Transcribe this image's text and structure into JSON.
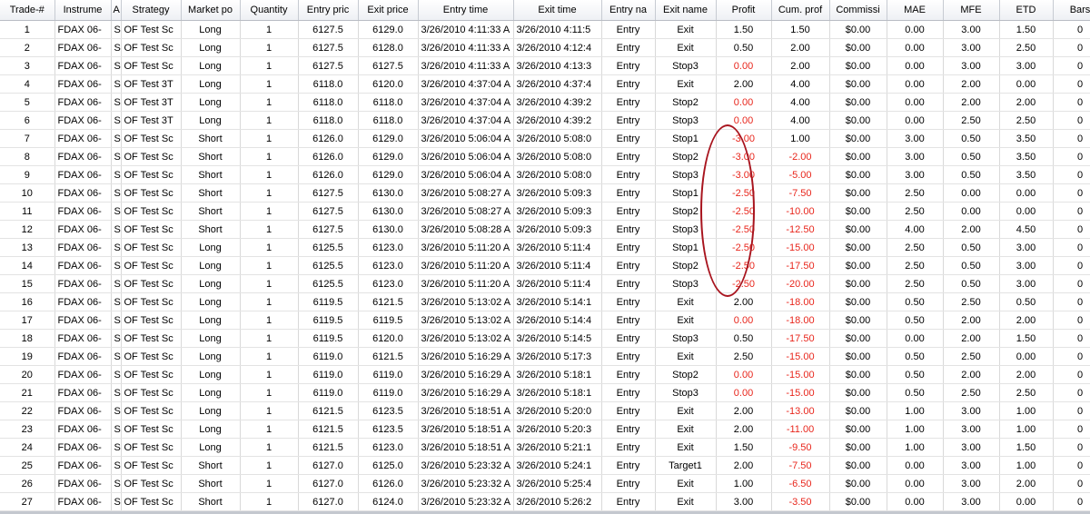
{
  "columns": [
    "Trade-#",
    "Instrume",
    "A",
    "Strategy",
    "Market po",
    "Quantity",
    "Entry pric",
    "Exit price",
    "Entry time",
    "Exit time",
    "Entry na",
    "Exit name",
    "Profit",
    "Cum. prof",
    "Commissi",
    "MAE",
    "MFE",
    "ETD",
    "Bars"
  ],
  "negative_color": "#e8261c",
  "annotation_color": "#a8141e",
  "rows": [
    [
      "1",
      "FDAX 06-",
      "S",
      "OF Test Sc",
      "Long",
      "1",
      "6127.5",
      "6129.0",
      "3/26/2010 4:11:33 A",
      "3/26/2010 4:11:5",
      "Entry",
      "Exit",
      "1.50",
      "1.50",
      "$0.00",
      "0.00",
      "3.00",
      "1.50",
      "0"
    ],
    [
      "2",
      "FDAX 06-",
      "S",
      "OF Test Sc",
      "Long",
      "1",
      "6127.5",
      "6128.0",
      "3/26/2010 4:11:33 A",
      "3/26/2010 4:12:4",
      "Entry",
      "Exit",
      "0.50",
      "2.00",
      "$0.00",
      "0.00",
      "3.00",
      "2.50",
      "0"
    ],
    [
      "3",
      "FDAX 06-",
      "S",
      "OF Test Sc",
      "Long",
      "1",
      "6127.5",
      "6127.5",
      "3/26/2010 4:11:33 A",
      "3/26/2010 4:13:3",
      "Entry",
      "Stop3",
      "0.00",
      "2.00",
      "$0.00",
      "0.00",
      "3.00",
      "3.00",
      "0"
    ],
    [
      "4",
      "FDAX 06-",
      "S",
      "OF Test 3T",
      "Long",
      "1",
      "6118.0",
      "6120.0",
      "3/26/2010 4:37:04 A",
      "3/26/2010 4:37:4",
      "Entry",
      "Exit",
      "2.00",
      "4.00",
      "$0.00",
      "0.00",
      "2.00",
      "0.00",
      "0"
    ],
    [
      "5",
      "FDAX 06-",
      "S",
      "OF Test 3T",
      "Long",
      "1",
      "6118.0",
      "6118.0",
      "3/26/2010 4:37:04 A",
      "3/26/2010 4:39:2",
      "Entry",
      "Stop2",
      "0.00",
      "4.00",
      "$0.00",
      "0.00",
      "2.00",
      "2.00",
      "0"
    ],
    [
      "6",
      "FDAX 06-",
      "S",
      "OF Test 3T",
      "Long",
      "1",
      "6118.0",
      "6118.0",
      "3/26/2010 4:37:04 A",
      "3/26/2010 4:39:2",
      "Entry",
      "Stop3",
      "0.00",
      "4.00",
      "$0.00",
      "0.00",
      "2.50",
      "2.50",
      "0"
    ],
    [
      "7",
      "FDAX 06-",
      "S",
      "OF Test Sc",
      "Short",
      "1",
      "6126.0",
      "6129.0",
      "3/26/2010 5:06:04 A",
      "3/26/2010 5:08:0",
      "Entry",
      "Stop1",
      "-3.00",
      "1.00",
      "$0.00",
      "3.00",
      "0.50",
      "3.50",
      "0"
    ],
    [
      "8",
      "FDAX 06-",
      "S",
      "OF Test Sc",
      "Short",
      "1",
      "6126.0",
      "6129.0",
      "3/26/2010 5:06:04 A",
      "3/26/2010 5:08:0",
      "Entry",
      "Stop2",
      "-3.00",
      "-2.00",
      "$0.00",
      "3.00",
      "0.50",
      "3.50",
      "0"
    ],
    [
      "9",
      "FDAX 06-",
      "S",
      "OF Test Sc",
      "Short",
      "1",
      "6126.0",
      "6129.0",
      "3/26/2010 5:06:04 A",
      "3/26/2010 5:08:0",
      "Entry",
      "Stop3",
      "-3.00",
      "-5.00",
      "$0.00",
      "3.00",
      "0.50",
      "3.50",
      "0"
    ],
    [
      "10",
      "FDAX 06-",
      "S",
      "OF Test Sc",
      "Short",
      "1",
      "6127.5",
      "6130.0",
      "3/26/2010 5:08:27 A",
      "3/26/2010 5:09:3",
      "Entry",
      "Stop1",
      "-2.50",
      "-7.50",
      "$0.00",
      "2.50",
      "0.00",
      "0.00",
      "0"
    ],
    [
      "11",
      "FDAX 06-",
      "S",
      "OF Test Sc",
      "Short",
      "1",
      "6127.5",
      "6130.0",
      "3/26/2010 5:08:27 A",
      "3/26/2010 5:09:3",
      "Entry",
      "Stop2",
      "-2.50",
      "-10.00",
      "$0.00",
      "2.50",
      "0.00",
      "0.00",
      "0"
    ],
    [
      "12",
      "FDAX 06-",
      "S",
      "OF Test Sc",
      "Short",
      "1",
      "6127.5",
      "6130.0",
      "3/26/2010 5:08:28 A",
      "3/26/2010 5:09:3",
      "Entry",
      "Stop3",
      "-2.50",
      "-12.50",
      "$0.00",
      "4.00",
      "2.00",
      "4.50",
      "0"
    ],
    [
      "13",
      "FDAX 06-",
      "S",
      "OF Test Sc",
      "Long",
      "1",
      "6125.5",
      "6123.0",
      "3/26/2010 5:11:20 A",
      "3/26/2010 5:11:4",
      "Entry",
      "Stop1",
      "-2.50",
      "-15.00",
      "$0.00",
      "2.50",
      "0.50",
      "3.00",
      "0"
    ],
    [
      "14",
      "FDAX 06-",
      "S",
      "OF Test Sc",
      "Long",
      "1",
      "6125.5",
      "6123.0",
      "3/26/2010 5:11:20 A",
      "3/26/2010 5:11:4",
      "Entry",
      "Stop2",
      "-2.50",
      "-17.50",
      "$0.00",
      "2.50",
      "0.50",
      "3.00",
      "0"
    ],
    [
      "15",
      "FDAX 06-",
      "S",
      "OF Test Sc",
      "Long",
      "1",
      "6125.5",
      "6123.0",
      "3/26/2010 5:11:20 A",
      "3/26/2010 5:11:4",
      "Entry",
      "Stop3",
      "-2.50",
      "-20.00",
      "$0.00",
      "2.50",
      "0.50",
      "3.00",
      "0"
    ],
    [
      "16",
      "FDAX 06-",
      "S",
      "OF Test Sc",
      "Long",
      "1",
      "6119.5",
      "6121.5",
      "3/26/2010 5:13:02 A",
      "3/26/2010 5:14:1",
      "Entry",
      "Exit",
      "2.00",
      "-18.00",
      "$0.00",
      "0.50",
      "2.50",
      "0.50",
      "0"
    ],
    [
      "17",
      "FDAX 06-",
      "S",
      "OF Test Sc",
      "Long",
      "1",
      "6119.5",
      "6119.5",
      "3/26/2010 5:13:02 A",
      "3/26/2010 5:14:4",
      "Entry",
      "Exit",
      "0.00",
      "-18.00",
      "$0.00",
      "0.50",
      "2.00",
      "2.00",
      "0"
    ],
    [
      "18",
      "FDAX 06-",
      "S",
      "OF Test Sc",
      "Long",
      "1",
      "6119.5",
      "6120.0",
      "3/26/2010 5:13:02 A",
      "3/26/2010 5:14:5",
      "Entry",
      "Stop3",
      "0.50",
      "-17.50",
      "$0.00",
      "0.00",
      "2.00",
      "1.50",
      "0"
    ],
    [
      "19",
      "FDAX 06-",
      "S",
      "OF Test Sc",
      "Long",
      "1",
      "6119.0",
      "6121.5",
      "3/26/2010 5:16:29 A",
      "3/26/2010 5:17:3",
      "Entry",
      "Exit",
      "2.50",
      "-15.00",
      "$0.00",
      "0.50",
      "2.50",
      "0.00",
      "0"
    ],
    [
      "20",
      "FDAX 06-",
      "S",
      "OF Test Sc",
      "Long",
      "1",
      "6119.0",
      "6119.0",
      "3/26/2010 5:16:29 A",
      "3/26/2010 5:18:1",
      "Entry",
      "Stop2",
      "0.00",
      "-15.00",
      "$0.00",
      "0.50",
      "2.00",
      "2.00",
      "0"
    ],
    [
      "21",
      "FDAX 06-",
      "S",
      "OF Test Sc",
      "Long",
      "1",
      "6119.0",
      "6119.0",
      "3/26/2010 5:16:29 A",
      "3/26/2010 5:18:1",
      "Entry",
      "Stop3",
      "0.00",
      "-15.00",
      "$0.00",
      "0.50",
      "2.50",
      "2.50",
      "0"
    ],
    [
      "22",
      "FDAX 06-",
      "S",
      "OF Test Sc",
      "Long",
      "1",
      "6121.5",
      "6123.5",
      "3/26/2010 5:18:51 A",
      "3/26/2010 5:20:0",
      "Entry",
      "Exit",
      "2.00",
      "-13.00",
      "$0.00",
      "1.00",
      "3.00",
      "1.00",
      "0"
    ],
    [
      "23",
      "FDAX 06-",
      "S",
      "OF Test Sc",
      "Long",
      "1",
      "6121.5",
      "6123.5",
      "3/26/2010 5:18:51 A",
      "3/26/2010 5:20:3",
      "Entry",
      "Exit",
      "2.00",
      "-11.00",
      "$0.00",
      "1.00",
      "3.00",
      "1.00",
      "0"
    ],
    [
      "24",
      "FDAX 06-",
      "S",
      "OF Test Sc",
      "Long",
      "1",
      "6121.5",
      "6123.0",
      "3/26/2010 5:18:51 A",
      "3/26/2010 5:21:1",
      "Entry",
      "Exit",
      "1.50",
      "-9.50",
      "$0.00",
      "1.00",
      "3.00",
      "1.50",
      "0"
    ],
    [
      "25",
      "FDAX 06-",
      "S",
      "OF Test Sc",
      "Short",
      "1",
      "6127.0",
      "6125.0",
      "3/26/2010 5:23:32 A",
      "3/26/2010 5:24:1",
      "Entry",
      "Target1",
      "2.00",
      "-7.50",
      "$0.00",
      "0.00",
      "3.00",
      "1.00",
      "0"
    ],
    [
      "26",
      "FDAX 06-",
      "S",
      "OF Test Sc",
      "Short",
      "1",
      "6127.0",
      "6126.0",
      "3/26/2010 5:23:32 A",
      "3/26/2010 5:25:4",
      "Entry",
      "Exit",
      "1.00",
      "-6.50",
      "$0.00",
      "0.00",
      "3.00",
      "2.00",
      "0"
    ],
    [
      "27",
      "FDAX 06-",
      "S",
      "OF Test Sc",
      "Short",
      "1",
      "6127.0",
      "6124.0",
      "3/26/2010 5:23:32 A",
      "3/26/2010 5:26:2",
      "Entry",
      "Exit",
      "3.00",
      "-3.50",
      "$0.00",
      "0.00",
      "3.00",
      "0.00",
      "0"
    ]
  ]
}
